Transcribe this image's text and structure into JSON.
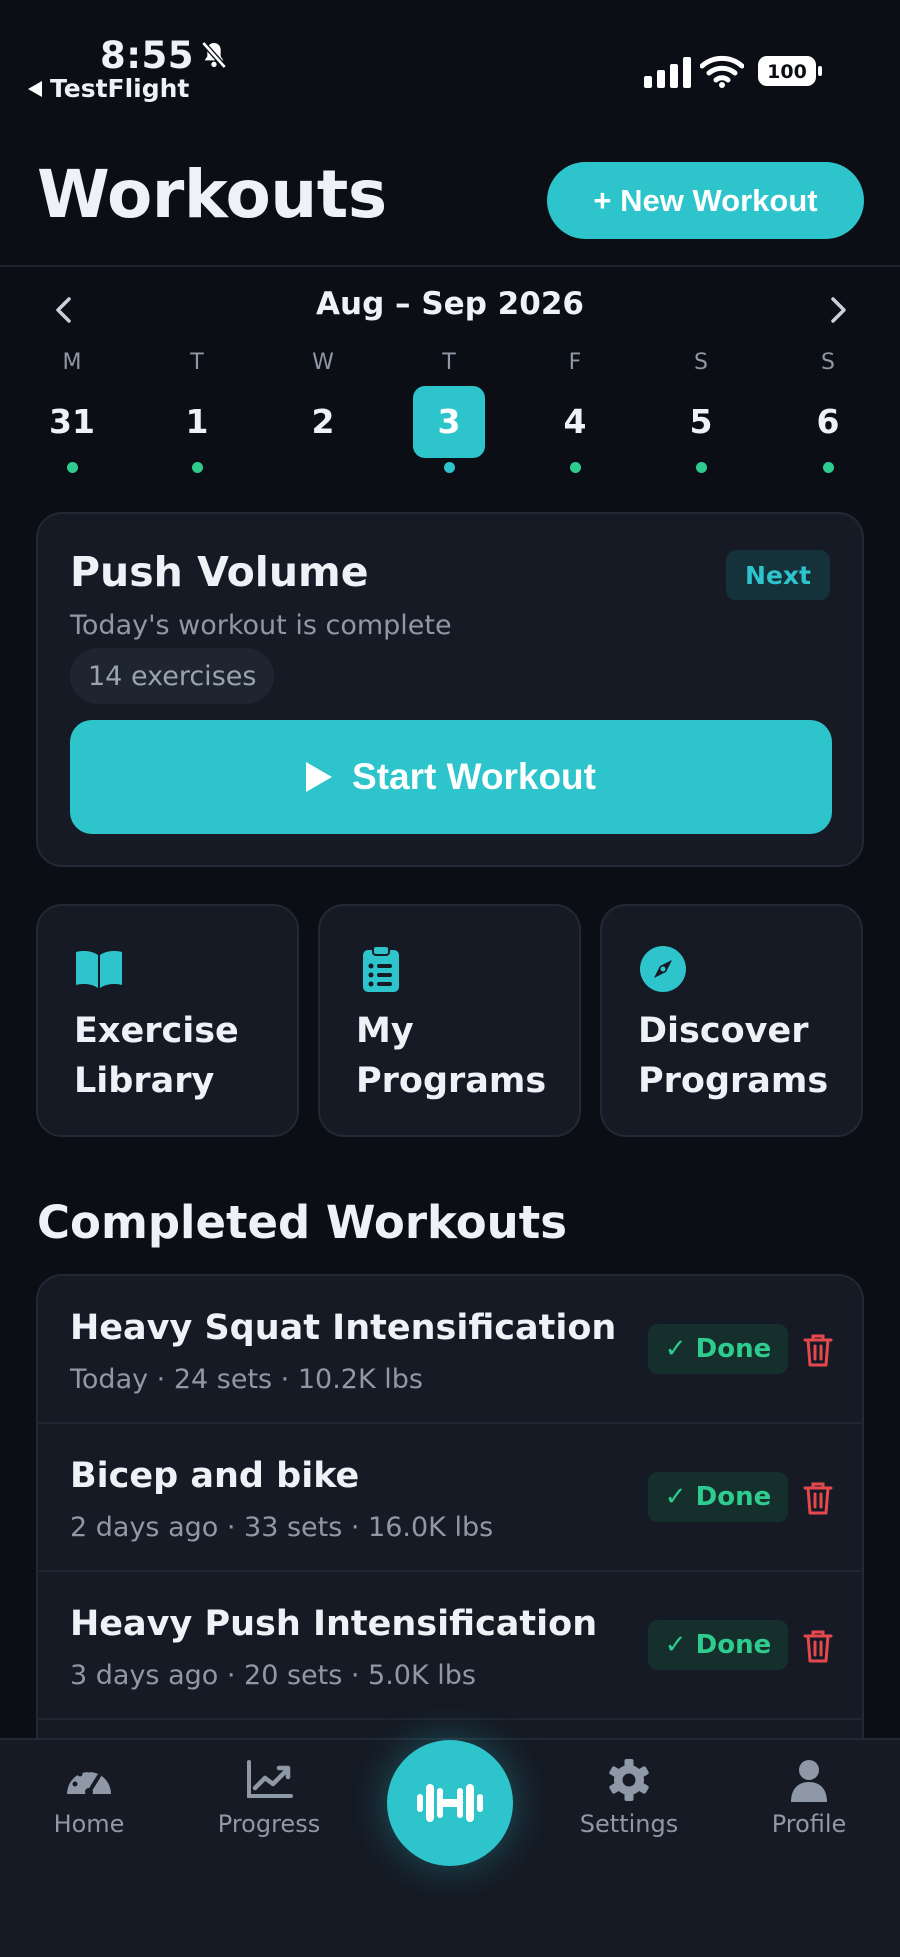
{
  "status": {
    "time": "8:55",
    "back_app": "TestFlight",
    "battery": "100"
  },
  "header": {
    "title": "Workouts",
    "new_button": "+ New Workout"
  },
  "calendar": {
    "range": "Aug – Sep 2026",
    "days": [
      {
        "letter": "M",
        "num": "31"
      },
      {
        "letter": "T",
        "num": "1"
      },
      {
        "letter": "W",
        "num": "2"
      },
      {
        "letter": "T",
        "num": "3",
        "active": true
      },
      {
        "letter": "F",
        "num": "4"
      },
      {
        "letter": "S",
        "num": "5"
      },
      {
        "letter": "S",
        "num": "6"
      }
    ]
  },
  "today": {
    "title": "Push Volume",
    "badge": "Next",
    "subtitle": "Today's workout is complete",
    "exercises": "14 exercises",
    "start_label": "Start Workout"
  },
  "tiles": [
    {
      "label": "Exercise\nLibrary",
      "icon": "book-icon"
    },
    {
      "label": "My\nPrograms",
      "icon": "clipboard-icon"
    },
    {
      "label": "Discover\nPrograms",
      "icon": "compass-icon"
    }
  ],
  "completed": {
    "title": "Completed Workouts",
    "done_label": "✓ Done",
    "items": [
      {
        "title": "Heavy Squat Intensification",
        "meta": "Today · 24 sets · 10.2K lbs"
      },
      {
        "title": "Bicep and bike",
        "meta": "2 days ago · 33 sets · 16.0K lbs"
      },
      {
        "title": "Heavy Push Intensification",
        "meta": "3 days ago · 20 sets · 5.0K lbs"
      }
    ]
  },
  "nav": {
    "home": "Home",
    "progress": "Progress",
    "settings": "Settings",
    "profile": "Profile"
  },
  "colors": {
    "accent": "#2ec4cc",
    "done": "#2ecc8f",
    "danger": "#e5484d",
    "background": "#0b0e14",
    "card": "#151a24"
  }
}
